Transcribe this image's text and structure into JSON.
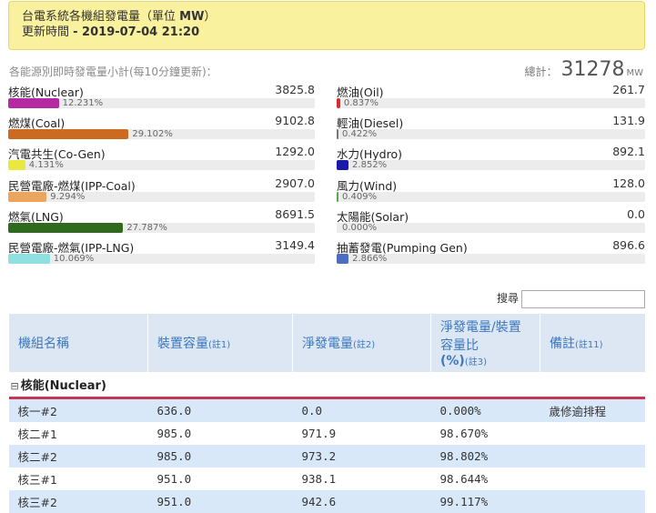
{
  "header": {
    "title_prefix": "台電系統各機組發電量（單位 ",
    "title_unit": "MW",
    "title_suffix": "）",
    "updated_label": "更新時間 ",
    "updated_time": "- 2019-07-04 21:20"
  },
  "summary": {
    "subtitle": "各能源別即時發電量小計(每10分鐘更新)：",
    "total_label": "總計：",
    "total_value": "31278",
    "total_unit": "MW"
  },
  "sources_left": [
    {
      "name": "核能(Nuclear)",
      "value": "3825.8",
      "pct": "12.231%",
      "fraction": 0.12231,
      "color": "#b52aa3"
    },
    {
      "name": "燃煤(Coal)",
      "value": "9102.8",
      "pct": "29.102%",
      "fraction": 0.29102,
      "color": "#cc6a1f"
    },
    {
      "name": "汽電共生(Co-Gen)",
      "value": "1292.0",
      "pct": "4.131%",
      "fraction": 0.04131,
      "color": "#e9e840"
    },
    {
      "name": "民營電廠-燃煤(IPP-Coal)",
      "value": "2907.0",
      "pct": "9.294%",
      "fraction": 0.09294,
      "color": "#eca55c"
    },
    {
      "name": "燃氣(LNG)",
      "value": "8691.5",
      "pct": "27.787%",
      "fraction": 0.27787,
      "color": "#306a1f"
    },
    {
      "name": "民營電廠-燃氣(IPP-LNG)",
      "value": "3149.4",
      "pct": "10.069%",
      "fraction": 0.10069,
      "color": "#8fe0e0"
    }
  ],
  "sources_right": [
    {
      "name": "燃油(Oil)",
      "value": "261.7",
      "pct": "0.837%",
      "fraction": 0.00837,
      "color": "#d82b2b"
    },
    {
      "name": "輕油(Diesel)",
      "value": "131.9",
      "pct": "0.422%",
      "fraction": 0.00422,
      "color": "#777777"
    },
    {
      "name": "水力(Hydro)",
      "value": "892.1",
      "pct": "2.852%",
      "fraction": 0.02852,
      "color": "#1a1aa8"
    },
    {
      "name": "風力(Wind)",
      "value": "128.0",
      "pct": "0.409%",
      "fraction": 0.00409,
      "color": "#5aa64a"
    },
    {
      "name": "太陽能(Solar)",
      "value": "0.0",
      "pct": "0.000%",
      "fraction": 0.0,
      "color": "#e8c400"
    },
    {
      "name": "抽蓄發電(Pumping Gen)",
      "value": "896.6",
      "pct": "2.866%",
      "fraction": 0.02866,
      "color": "#4d6ec0"
    }
  ],
  "search": {
    "label": "搜尋"
  },
  "table": {
    "headers": [
      {
        "text": "機組名稱",
        "note": ""
      },
      {
        "text": "裝置容量",
        "note": "(註1)"
      },
      {
        "text": "淨發電量",
        "note": "(註2)"
      },
      {
        "text": "淨發電量/裝置容量比",
        "note2": "(%)",
        "note": "(註3)"
      },
      {
        "text": "備註",
        "note": "(註11)"
      }
    ],
    "group": {
      "toggle": "⊟",
      "name": "核能(Nuclear)"
    },
    "rows": [
      {
        "unit": "核一#2",
        "capacity": "636.0",
        "output": "0.0",
        "ratio": "0.000%",
        "remark": "歲修逾排程"
      },
      {
        "unit": "核二#1",
        "capacity": "985.0",
        "output": "971.9",
        "ratio": "98.670%",
        "remark": ""
      },
      {
        "unit": "核二#2",
        "capacity": "985.0",
        "output": "973.2",
        "ratio": "98.802%",
        "remark": ""
      },
      {
        "unit": "核三#1",
        "capacity": "951.0",
        "output": "938.1",
        "ratio": "98.644%",
        "remark": ""
      },
      {
        "unit": "核三#2",
        "capacity": "951.0",
        "output": "942.6",
        "ratio": "99.117%",
        "remark": ""
      }
    ]
  }
}
